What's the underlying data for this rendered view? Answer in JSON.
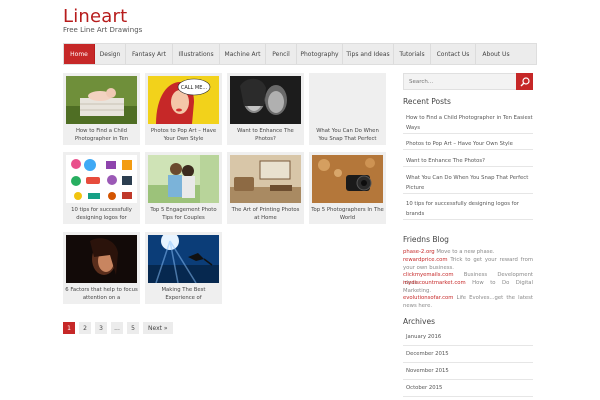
{
  "site": {
    "title": "Lineart",
    "tagline": "Free Line Art Drawings"
  },
  "nav": {
    "items": [
      "Home",
      "Design",
      "Fantasy Art",
      "Illustrations",
      "Machine Art",
      "Pencil",
      "Photography",
      "Tips and Ideas",
      "Tutorials",
      "Contact Us",
      "About Us"
    ],
    "active": "Home"
  },
  "posts": [
    {
      "title": "How to Find a Child Photographer in Ten",
      "image": "baby in a wooden crate on grass"
    },
    {
      "title": "Photos to Pop Art – Have Your Own Style",
      "image": "pop art woman with speech bubble"
    },
    {
      "title": "Want to Enhance The Photos?",
      "image": "black and white portrait of two women"
    },
    {
      "title": "What You Can Do When You Snap That Perfect",
      "image": ""
    },
    {
      "title": "10 tips for successfully designing logos for",
      "image": "collection of colorful logos"
    },
    {
      "title": "Top 5 Engagement Photo Tips for Couples",
      "image": "couple embracing outdoors"
    },
    {
      "title": "The Art of Printing Photos at Home",
      "image": "living room interior"
    },
    {
      "title": "Top 5 Photographers In The World",
      "image": "camera lens with bokeh"
    },
    {
      "title": "6 Factors that help to focus attention on a",
      "image": "dark portrait of a woman"
    },
    {
      "title": "Making The Best Experience of",
      "image": "diver underwater with sun rays"
    }
  ],
  "speech_bubble": "CALL ME...",
  "pagination": {
    "pages": [
      "1",
      "2",
      "3",
      "...",
      "5"
    ],
    "current": "1",
    "next_label": "Next »"
  },
  "sidebar": {
    "search_placeholder": "Search...",
    "recent_title": "Recent Posts",
    "recent_posts": [
      "How to Find a Child Photographer in Ten Easiest Ways",
      "Photos to Pop Art – Have Your Own Style",
      "Want to Enhance The Photos?",
      "What You Can Do When You Snap That Perfect Picture",
      "10 tips for successfully designing logos for brands"
    ],
    "friends_title": "Friedns Blog",
    "friends": [
      {
        "site": "phase-2.org",
        "text": "Move to a new phase."
      },
      {
        "site": "rewardprice.com",
        "text": "Trick to get your reward from your own business."
      },
      {
        "site": "clickmyemails.com",
        "text": "Business Development ideas."
      },
      {
        "site": "mydiscountmarket.com",
        "text": "How to Do Digital Marketing."
      },
      {
        "site": "evolutionsofar.com",
        "text": "Life Evolves...get the latest news here."
      }
    ],
    "archives_title": "Archives",
    "archives": [
      "January 2016",
      "December 2015",
      "November 2015",
      "October 2015"
    ]
  },
  "colors": {
    "accent": "#c62828",
    "nav_bg": "#ececec",
    "card_bg": "#efefef"
  }
}
